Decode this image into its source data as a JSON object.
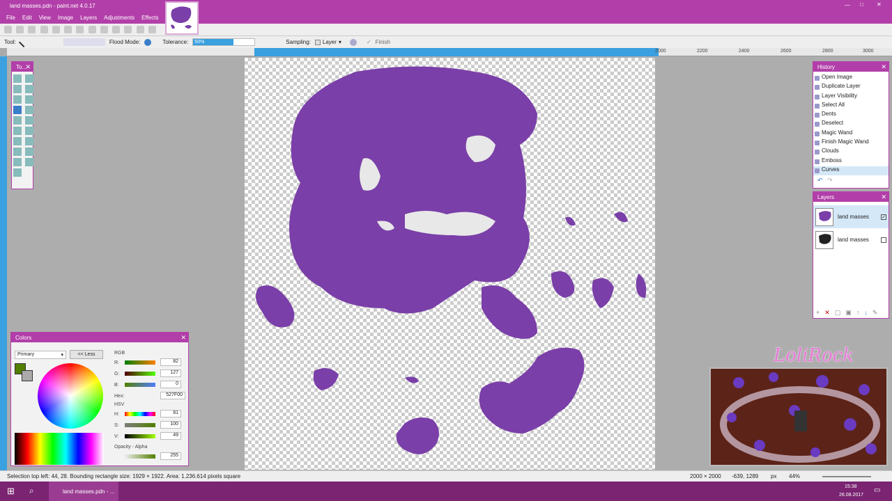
{
  "window": {
    "title": "land masses.pdn - paint.net 4.0.17"
  },
  "menu": [
    "File",
    "Edit",
    "View",
    "Image",
    "Layers",
    "Adjustments",
    "Effects"
  ],
  "toolbar2": {
    "tool_label": "Tool:",
    "flood_mode_label": "Flood Mode:",
    "tolerance_label": "Tolerance:",
    "tolerance_value": "50%",
    "sampling_label": "Sampling:",
    "sampling_value": "Layer",
    "finish_label": "Finish"
  },
  "ruler": {
    "ticks": [
      "2000",
      "2200",
      "2400",
      "2600",
      "2800",
      "3000"
    ]
  },
  "tools_panel": {
    "title": "To..."
  },
  "history": {
    "title": "History",
    "items": [
      "Open Image",
      "Duplicate Layer",
      "Layer Visibility",
      "Select All",
      "Dents",
      "Deselect",
      "Magic Wand",
      "Finish Magic Wand",
      "Clouds",
      "Emboss",
      "Curves"
    ]
  },
  "layers": {
    "title": "Layers",
    "items": [
      {
        "name": "land masses",
        "visible": true
      },
      {
        "name": "land masses",
        "visible": false
      }
    ]
  },
  "colors": {
    "title": "Colors",
    "mode": "Primary",
    "less_button": "<< Less",
    "rgb_label": "RGB",
    "r_label": "R:",
    "r": "82",
    "g_label": "G:",
    "g": "127",
    "b_label": "B:",
    "b": "0",
    "hex_label": "Hex:",
    "hex": "527F00",
    "hsv_label": "HSV",
    "h_label": "H:",
    "h": "81",
    "s_label": "S:",
    "s": "100",
    "v_label": "V:",
    "v": "49",
    "opacity_label": "Opacity - Alpha",
    "alpha": "255",
    "primary_color": "#527F00"
  },
  "status": {
    "selection": "Selection top left: 44, 28. Bounding rectangle size: 1929 × 1922. Area: 1.236.614 pixels square",
    "image_size": "2000 × 2000",
    "cursor": "-639, 1289",
    "units": "px",
    "zoom": "44%"
  },
  "taskbar": {
    "app": "land masses.pdn - ...",
    "time": "15:38",
    "date": "26.08.2017"
  },
  "watermark": {
    "text": "LoliRock"
  },
  "colors_theme": {
    "accent": "#b23fa9",
    "land": "#7a3fa8"
  }
}
